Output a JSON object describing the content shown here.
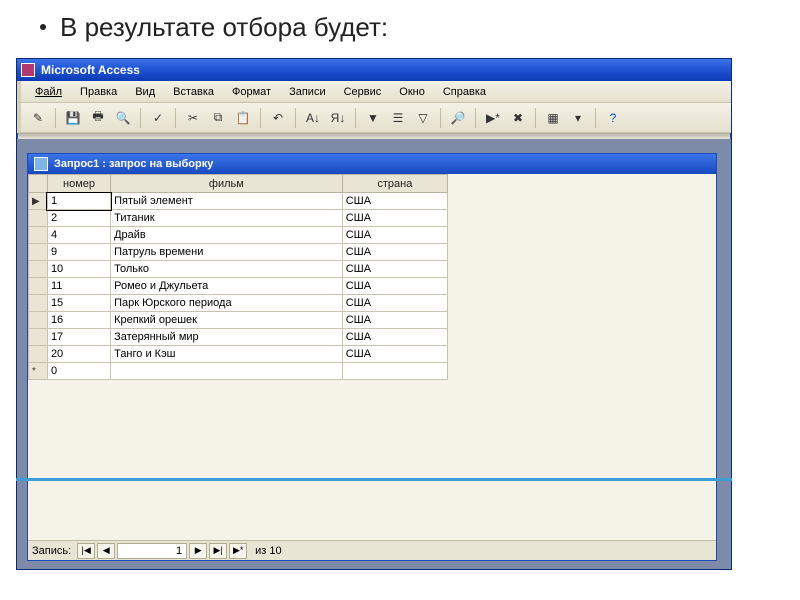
{
  "slide": {
    "heading": "В результате отбора будет:"
  },
  "app": {
    "title": "Microsoft Access"
  },
  "menu": {
    "file": "Файл",
    "edit": "Правка",
    "view": "Вид",
    "insert": "Вставка",
    "format": "Формат",
    "records": "Записи",
    "service": "Сервис",
    "window": "Окно",
    "help": "Справка"
  },
  "child": {
    "title": "Запрос1 : запрос на выборку"
  },
  "columns": {
    "number": "номер",
    "film": "фильм",
    "country": "страна"
  },
  "rows": [
    {
      "n": "1",
      "film": "Пятый элемент",
      "country": "США"
    },
    {
      "n": "2",
      "film": "Титаник",
      "country": "США"
    },
    {
      "n": "4",
      "film": "Драйв",
      "country": "США"
    },
    {
      "n": "9",
      "film": "Патруль времени",
      "country": "США"
    },
    {
      "n": "10",
      "film": "Только",
      "country": "США"
    },
    {
      "n": "11",
      "film": "Ромео и Джульета",
      "country": "США"
    },
    {
      "n": "15",
      "film": " Парк Юрского периода",
      "country": "США"
    },
    {
      "n": "16",
      "film": "Крепкий орешек",
      "country": "США"
    },
    {
      "n": "17",
      "film": "Затерянный мир",
      "country": "США"
    },
    {
      "n": "20",
      "film": "Танго и Кэш",
      "country": "США"
    }
  ],
  "newrow": {
    "n": "0",
    "marker": "*"
  },
  "nav": {
    "label": "Запись:",
    "value": "1",
    "of": "из 10"
  },
  "icons": {
    "first": "|◀",
    "prev": "◀",
    "next": "▶",
    "last": "▶|",
    "new": "▶*",
    "tri": "▶"
  }
}
